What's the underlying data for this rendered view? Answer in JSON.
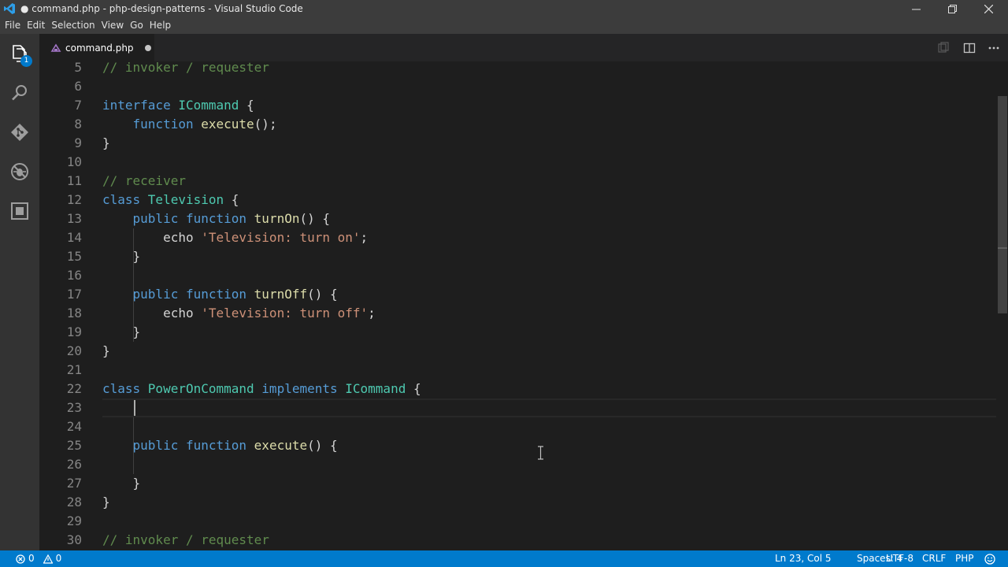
{
  "window": {
    "title": "● command.php - php-design-patterns - Visual Studio Code"
  },
  "menu": {
    "items": [
      "File",
      "Edit",
      "Selection",
      "View",
      "Go",
      "Help"
    ]
  },
  "activity_bar": {
    "items": [
      {
        "icon": "explorer-icon",
        "badge": "1"
      },
      {
        "icon": "search-icon"
      },
      {
        "icon": "git-icon"
      },
      {
        "icon": "debug-icon"
      },
      {
        "icon": "extensions-icon"
      }
    ]
  },
  "tab": {
    "label": "command.php",
    "icon": "php-file-icon",
    "dirty": true
  },
  "editor": {
    "lines": [
      {
        "n": "5",
        "tokens": [
          {
            "t": "// invoker / requester",
            "c": "cm"
          }
        ]
      },
      {
        "n": "6",
        "tokens": []
      },
      {
        "n": "7",
        "tokens": [
          {
            "t": "interface ",
            "c": "kw"
          },
          {
            "t": "ICommand",
            "c": "ty"
          },
          {
            "t": " {",
            "c": "pl"
          }
        ]
      },
      {
        "n": "8",
        "tokens": [
          {
            "t": "    ",
            "c": "pl"
          },
          {
            "t": "function ",
            "c": "kw"
          },
          {
            "t": "execute",
            "c": "fn"
          },
          {
            "t": "();",
            "c": "pl"
          }
        ]
      },
      {
        "n": "9",
        "tokens": [
          {
            "t": "}",
            "c": "pl"
          }
        ]
      },
      {
        "n": "10",
        "tokens": []
      },
      {
        "n": "11",
        "tokens": [
          {
            "t": "// receiver",
            "c": "cm"
          }
        ]
      },
      {
        "n": "12",
        "tokens": [
          {
            "t": "class ",
            "c": "kw"
          },
          {
            "t": "Television",
            "c": "ty"
          },
          {
            "t": " {",
            "c": "pl"
          }
        ]
      },
      {
        "n": "13",
        "tokens": [
          {
            "t": "    ",
            "c": "pl"
          },
          {
            "t": "public ",
            "c": "kw"
          },
          {
            "t": "function ",
            "c": "kw"
          },
          {
            "t": "turnOn",
            "c": "fn"
          },
          {
            "t": "() {",
            "c": "pl"
          }
        ]
      },
      {
        "n": "14",
        "tokens": [
          {
            "t": "        ",
            "c": "pl"
          },
          {
            "t": "echo ",
            "c": "pl"
          },
          {
            "t": "'Television: turn on'",
            "c": "str"
          },
          {
            "t": ";",
            "c": "pl"
          }
        ]
      },
      {
        "n": "15",
        "tokens": [
          {
            "t": "    }",
            "c": "pl"
          }
        ]
      },
      {
        "n": "16",
        "tokens": []
      },
      {
        "n": "17",
        "tokens": [
          {
            "t": "    ",
            "c": "pl"
          },
          {
            "t": "public ",
            "c": "kw"
          },
          {
            "t": "function ",
            "c": "kw"
          },
          {
            "t": "turnOff",
            "c": "fn"
          },
          {
            "t": "() {",
            "c": "pl"
          }
        ]
      },
      {
        "n": "18",
        "tokens": [
          {
            "t": "        ",
            "c": "pl"
          },
          {
            "t": "echo ",
            "c": "pl"
          },
          {
            "t": "'Television: turn off'",
            "c": "str"
          },
          {
            "t": ";",
            "c": "pl"
          }
        ]
      },
      {
        "n": "19",
        "tokens": [
          {
            "t": "    }",
            "c": "pl"
          }
        ]
      },
      {
        "n": "20",
        "tokens": [
          {
            "t": "}",
            "c": "pl"
          }
        ]
      },
      {
        "n": "21",
        "tokens": []
      },
      {
        "n": "22",
        "tokens": [
          {
            "t": "class ",
            "c": "kw"
          },
          {
            "t": "PowerOnCommand ",
            "c": "ty"
          },
          {
            "t": "implements ",
            "c": "kw"
          },
          {
            "t": "ICommand",
            "c": "ty"
          },
          {
            "t": " {",
            "c": "pl"
          }
        ]
      },
      {
        "n": "23",
        "tokens": [],
        "current": true
      },
      {
        "n": "24",
        "tokens": []
      },
      {
        "n": "25",
        "tokens": [
          {
            "t": "    ",
            "c": "pl"
          },
          {
            "t": "public ",
            "c": "kw"
          },
          {
            "t": "function ",
            "c": "kw"
          },
          {
            "t": "execute",
            "c": "fn"
          },
          {
            "t": "() {",
            "c": "pl"
          }
        ]
      },
      {
        "n": "26",
        "tokens": []
      },
      {
        "n": "27",
        "tokens": [
          {
            "t": "    }",
            "c": "pl"
          }
        ]
      },
      {
        "n": "28",
        "tokens": [
          {
            "t": "}",
            "c": "pl"
          }
        ]
      },
      {
        "n": "29",
        "tokens": []
      },
      {
        "n": "30",
        "tokens": [
          {
            "t": "// invoker / requester",
            "c": "cm"
          }
        ]
      }
    ]
  },
  "status_bar": {
    "errors": "0",
    "warnings": "0",
    "position": "Ln 23, Col 5",
    "spaces": "Spaces: 4",
    "encoding": "UTF-8",
    "eol": "CRLF",
    "language": "PHP"
  },
  "colors": {
    "accent": "#007acc",
    "keyword": "#569cd6",
    "type": "#4ec9b0",
    "function": "#dcdcaa",
    "string": "#ce9178",
    "comment": "#608b4e"
  }
}
